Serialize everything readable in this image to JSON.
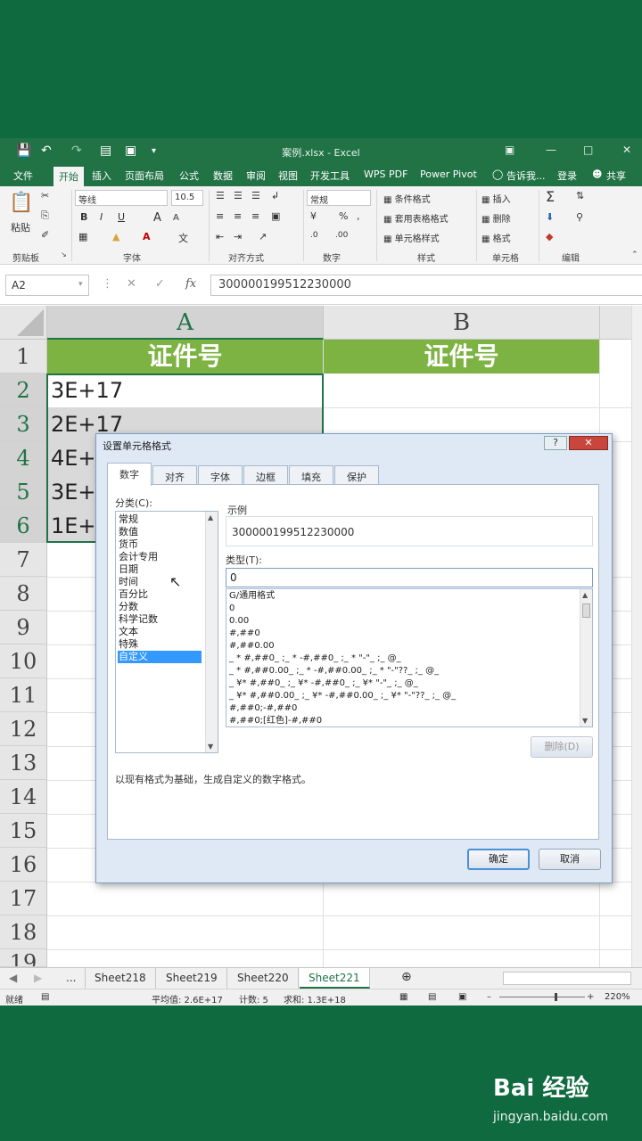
{
  "window": {
    "title": "案例.xlsx - Excel"
  },
  "ribbon_tabs": [
    "文件",
    "开始",
    "插入",
    "页面布局",
    "公式",
    "数据",
    "审阅",
    "视图",
    "开发工具",
    "WPS PDF",
    "Power Pivot",
    "告诉我...",
    "登录",
    "共享"
  ],
  "ribbon": {
    "clipboard": {
      "paste": "粘贴",
      "group": "剪贴板"
    },
    "font": {
      "name": "等线",
      "size": "10.5",
      "bold": "B",
      "italic": "I",
      "underline": "U",
      "grow": "A",
      "shrink": "A",
      "group": "字体"
    },
    "align": {
      "group": "对齐方式"
    },
    "number": {
      "format": "常规",
      "group": "数字"
    },
    "styles": {
      "conditional": "条件格式",
      "table": "套用表格格式",
      "cell": "单元格样式",
      "group": "样式"
    },
    "cells": {
      "insert": "插入",
      "delete": "删除",
      "format": "格式",
      "group": "单元格"
    },
    "editing": {
      "group": "编辑"
    }
  },
  "formula_bar": {
    "name_box": "A2",
    "formula": "300000199512230000"
  },
  "sheet": {
    "columns": [
      "A",
      "B"
    ],
    "rows": [
      "1",
      "2",
      "3",
      "4",
      "5",
      "6",
      "7",
      "8",
      "9",
      "10",
      "11",
      "12",
      "13",
      "14",
      "15",
      "16",
      "17",
      "18",
      "19"
    ],
    "header_a": "证件号",
    "header_b": "证件号",
    "cells": [
      "3E+17",
      "2E+17",
      "4E+",
      "3E+",
      "1E+"
    ]
  },
  "sheet_tabs": {
    "more": "...",
    "tabs": [
      "Sheet218",
      "Sheet219",
      "Sheet220",
      "Sheet221"
    ],
    "active": "Sheet221"
  },
  "status": {
    "ready": "就绪",
    "average": "平均值: 2.6E+17",
    "count": "计数: 5",
    "sum": "求和: 1.3E+18",
    "zoom": "220%"
  },
  "dialog": {
    "title": "设置单元格格式",
    "help": "?",
    "tabs": [
      "数字",
      "对齐",
      "字体",
      "边框",
      "填充",
      "保护"
    ],
    "category_label": "分类(C):",
    "categories": [
      "常规",
      "数值",
      "货币",
      "会计专用",
      "日期",
      "时间",
      "百分比",
      "分数",
      "科学记数",
      "文本",
      "特殊",
      "自定义"
    ],
    "selected_category": "自定义",
    "sample_label": "示例",
    "sample_value": "300000199512230000",
    "type_label": "类型(T):",
    "type_value": "0",
    "formats": [
      "G/通用格式",
      "0",
      "0.00",
      "#,##0",
      "#,##0.00",
      "_ * #,##0_ ;_ * -#,##0_ ;_ * \"-\"_ ;_ @_",
      "_ * #,##0.00_ ;_ * -#,##0.00_ ;_ * \"-\"??_ ;_ @_",
      "_ ¥* #,##0_ ;_ ¥* -#,##0_ ;_ ¥* \"-\"_ ;_ @_",
      "_ ¥* #,##0.00_ ;_ ¥* -#,##0.00_ ;_ ¥* \"-\"??_ ;_ @_",
      "#,##0;-#,##0",
      "#,##0;[红色]-#,##0"
    ],
    "delete_button": "删除(D)",
    "description": "以现有格式为基础，生成自定义的数字格式。",
    "ok_button": "确定",
    "cancel_button": "取消"
  },
  "watermark": {
    "logo": "Bai 经验",
    "url": "jingyan.baidu.com"
  },
  "colors": {
    "excel_green": "#217346",
    "header_fill": "#7cb342",
    "background": "#106a40"
  }
}
